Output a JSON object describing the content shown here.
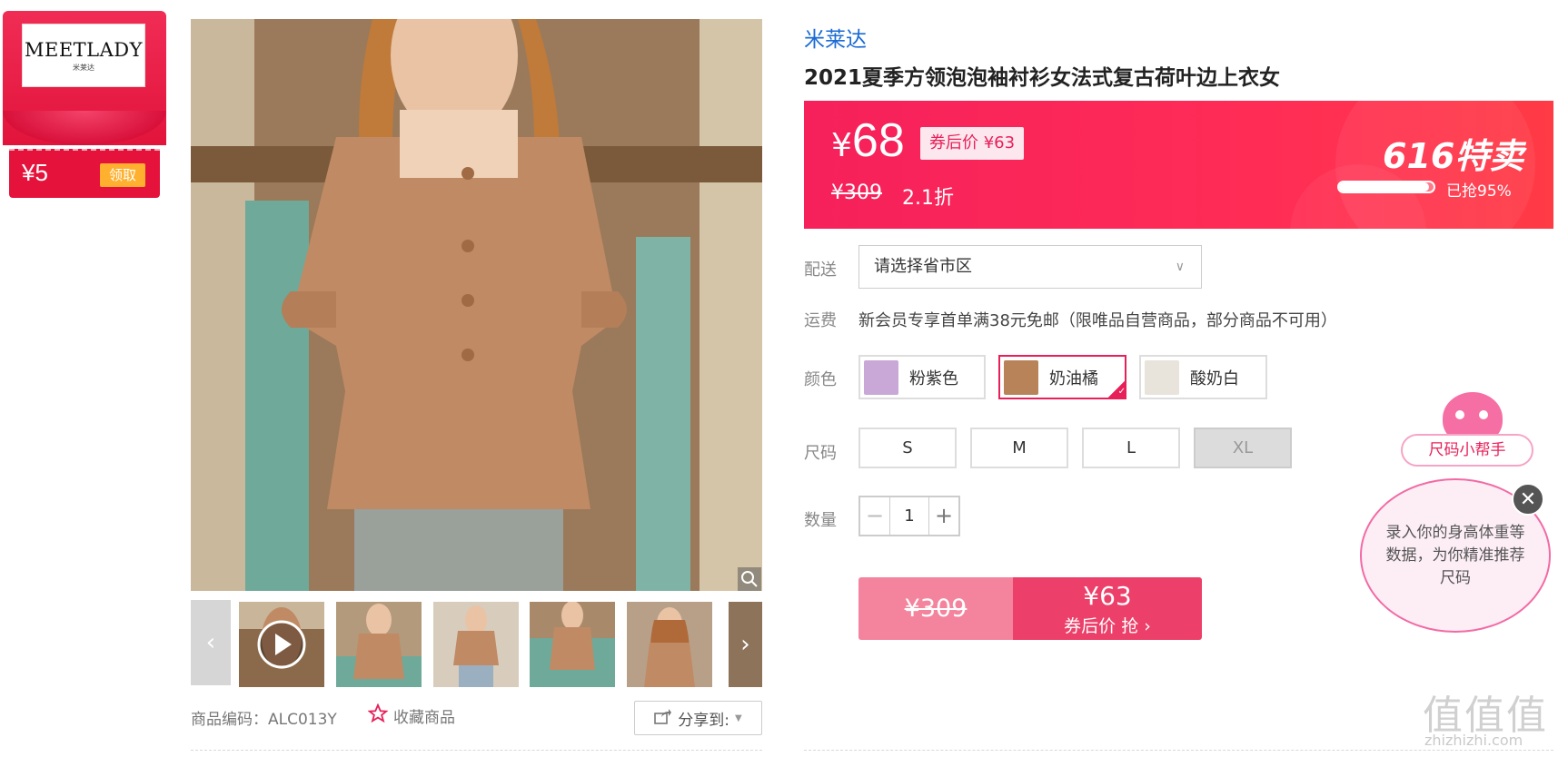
{
  "coupon": {
    "brand": "MEETLADY",
    "brand_sub": "米莱达",
    "amount": "¥5",
    "claim": "领取"
  },
  "gallery": {
    "prev_icon": "chevron-left-icon",
    "next_icon": "chevron-right-icon",
    "thumbs": [
      "video",
      "front",
      "side",
      "full",
      "detail",
      "back"
    ]
  },
  "meta": {
    "sku_label": "商品编码：",
    "sku_value": "ALC013Y",
    "fav_label": "收藏商品",
    "share_label": "分享到:"
  },
  "product": {
    "store": "米莱达",
    "title": "2021夏季方领泡泡袖衬衫女法式复古荷叶边上衣女"
  },
  "promo": {
    "currency": "¥",
    "price": "68",
    "coupon_price": "券后价 ¥63",
    "original_price": "¥309",
    "discount": "2.1折",
    "badge": "616特卖",
    "sold_percent": 95,
    "sold_text": "已抢95%"
  },
  "options": {
    "delivery_label": "配送",
    "delivery_placeholder": "请选择省市区",
    "shipping_label": "运费",
    "shipping_text": "新会员专享首单满38元免邮（限唯品自营商品，部分商品不可用）",
    "color_label": "颜色",
    "colors": [
      {
        "name": "粉紫色",
        "swatch": "#c9a8d8",
        "selected": false
      },
      {
        "name": "奶油橘",
        "swatch": "#b88358",
        "selected": true
      },
      {
        "name": "酸奶白",
        "swatch": "#e8e4dc",
        "selected": false
      }
    ],
    "size_label": "尺码",
    "sizes": [
      {
        "name": "S",
        "disabled": false
      },
      {
        "name": "M",
        "disabled": false
      },
      {
        "name": "L",
        "disabled": false
      },
      {
        "name": "XL",
        "disabled": true
      }
    ],
    "qty_label": "数量",
    "qty_value": "1",
    "qty_minus": "−",
    "qty_plus": "+"
  },
  "buy": {
    "original": "¥309",
    "price": "¥63",
    "action": "券后价 抢 ›"
  },
  "helper": {
    "title": "尺码小帮手",
    "message": "录入你的身高体重等数据，为你精准推荐尺码",
    "close": "✕"
  },
  "watermark": {
    "main": "值值值",
    "sub": "zhizhizhi.com"
  },
  "colors": {
    "accent": "#e8205a",
    "store_link": "#1a6ad5"
  }
}
